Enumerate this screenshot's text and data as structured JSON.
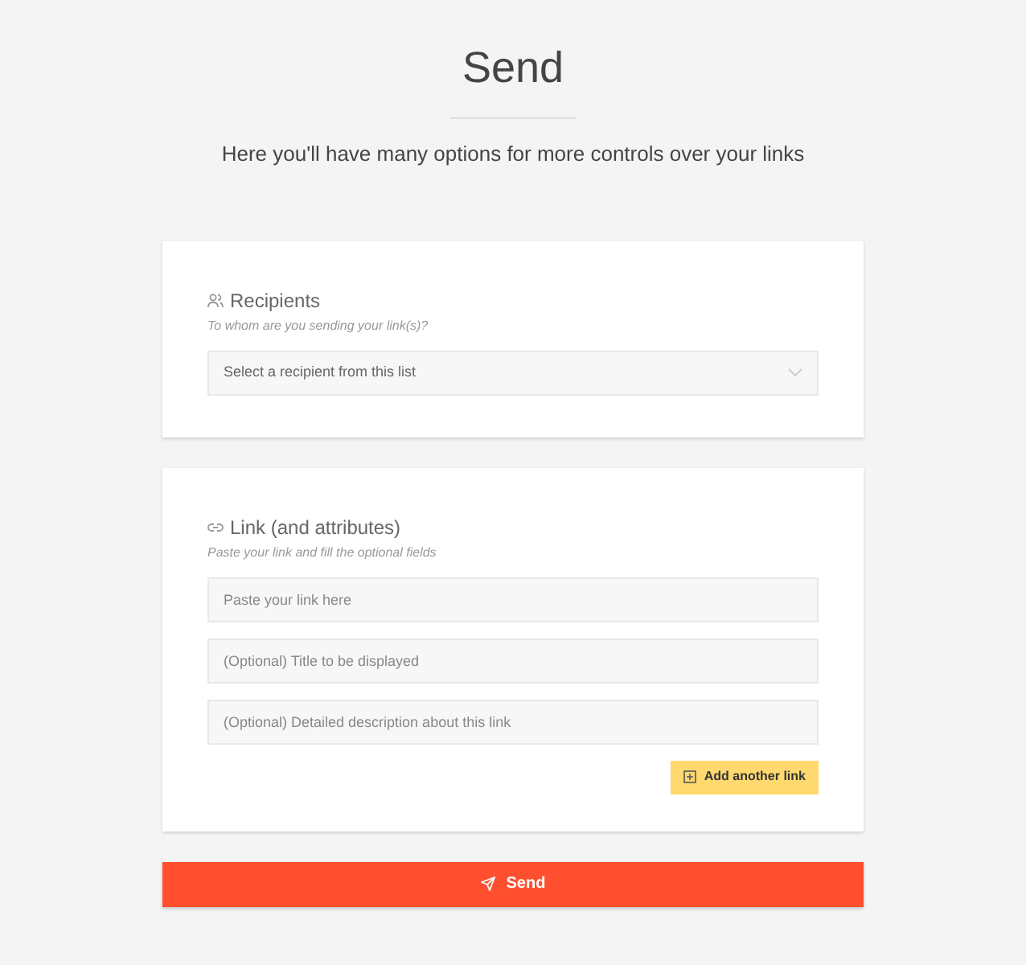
{
  "title": "Send",
  "subtitle": "Here you'll have many options for more controls over your links",
  "recipients": {
    "heading": "Recipients",
    "hint": "To whom are you sending your link(s)?",
    "select": {
      "placeholder": "Select a recipient from this list"
    }
  },
  "link": {
    "heading": "Link (and attributes)",
    "hint": "Paste your link and fill the optional fields",
    "fields": [
      {
        "placeholder": "Paste your link here"
      },
      {
        "placeholder": "(Optional) Title to be displayed"
      },
      {
        "placeholder": "(Optional) Detailed description about this link"
      }
    ],
    "add_button": "Add another link"
  },
  "send_button": "Send"
}
